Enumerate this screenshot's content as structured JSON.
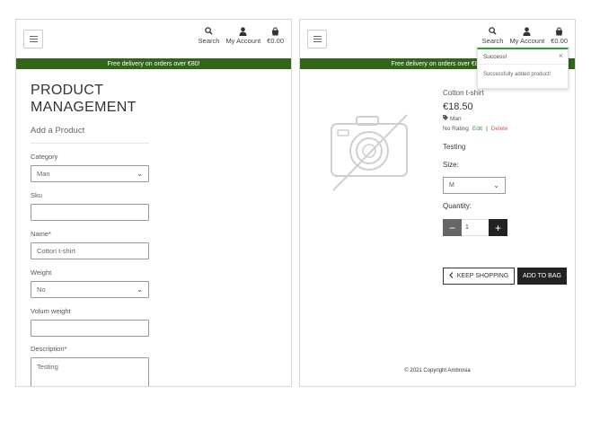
{
  "header": {
    "search_label": "Search",
    "account_label": "My Account",
    "bag_total": "€0.00",
    "banner_text": "Free delivery on orders over €80!"
  },
  "form": {
    "title": "PRODUCT MANAGEMENT",
    "subtitle": "Add a Product",
    "category_label": "Category",
    "category_value": "Man",
    "sku_label": "Sku",
    "sku_value": "",
    "name_label": "Name*",
    "name_value": "Cotton t-shirt",
    "weight_label": "Weight",
    "weight_value": "No",
    "volum_label": "Volum weight",
    "volum_value": "",
    "description_label": "Description*",
    "description_value": "Testing"
  },
  "product": {
    "name": "Cotton t-shirt",
    "price": "€18.50",
    "category": "Man",
    "rating": "No Rating",
    "edit_label": "Edit",
    "separator": "|",
    "delete_label": "Delete",
    "description": "Testing",
    "size_label": "Size:",
    "size_value": "M",
    "quantity_label": "Quantity:",
    "quantity_value": "1",
    "minus_label": "−",
    "plus_label": "+",
    "keep_shopping_label": "KEEP SHOPPING",
    "add_to_bag_label": "ADD TO BAG"
  },
  "toast": {
    "title": "Success!",
    "message": "Successfully added product!",
    "close_label": "×"
  },
  "footer": {
    "copyright": "© 2021 Copyright Ambrosia"
  },
  "colors": {
    "banner": "#2f6617",
    "success": "#2e9e3c",
    "delete": "#d9534f",
    "dark_button": "#222222"
  }
}
